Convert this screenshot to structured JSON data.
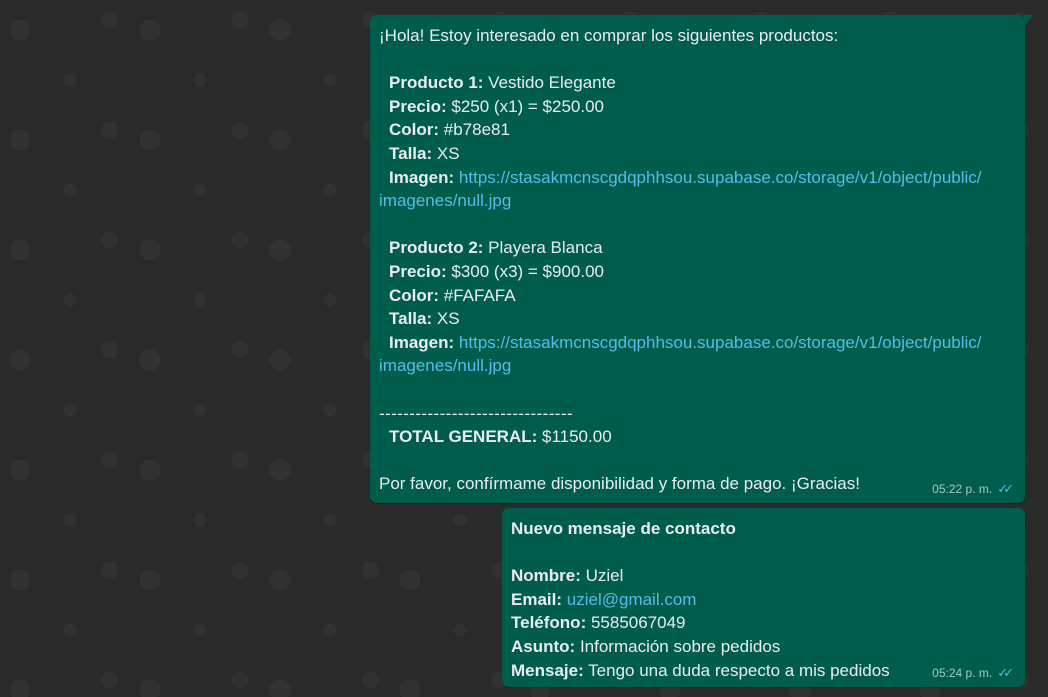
{
  "messages": [
    {
      "intro": "¡Hola! Estoy interesado en comprar los siguientes productos:",
      "products": [
        {
          "product_label": "Producto 1:",
          "product_value": " Vestido Elegante",
          "price_label": "Precio:",
          "price_value": " $250 (x1) = $250.00",
          "color_label": "Color:",
          "color_value": " #b78e81",
          "size_label": "Talla:",
          "size_value": " XS",
          "image_label": "Imagen:",
          "image_url_1": "https://stasakmcnscgdqphhsou.supabase.co/storage/v1/object/public/",
          "image_url_2": "imagenes/null.jpg"
        },
        {
          "product_label": "Producto 2:",
          "product_value": " Playera Blanca",
          "price_label": "Precio:",
          "price_value": " $300 (x3) = $900.00",
          "color_label": "Color:",
          "color_value": " #FAFAFA",
          "size_label": "Talla:",
          "size_value": " XS",
          "image_label": "Imagen:",
          "image_url_1": "https://stasakmcnscgdqphhsou.supabase.co/storage/v1/object/public/",
          "image_url_2": "imagenes/null.jpg"
        }
      ],
      "separator": "--------------------------------",
      "total_label": "TOTAL GENERAL:",
      "total_value": " $1150.00",
      "closing": "Por favor, confírmame disponibilidad y forma de pago. ¡Gracias!",
      "time": "05:22 p. m."
    },
    {
      "title": "Nuevo mensaje de contacto",
      "name_label": "Nombre:",
      "name_value": " Uziel",
      "email_label": "Email:",
      "email_value": "uziel@gmail.com",
      "phone_label": "Teléfono:",
      "phone_value": " 5585067049",
      "subject_label": "Asunto:",
      "subject_value": " Información sobre pedidos",
      "message_label": "Mensaje:",
      "message_value": " Tengo una duda respecto a mis pedidos",
      "time": "05:24 p. m."
    }
  ],
  "colors": {
    "bubble": "#005c4b",
    "link": "#53bdeb",
    "background": "#2a2a2a"
  },
  "icons": {
    "read_receipt": "double-check-icon"
  }
}
